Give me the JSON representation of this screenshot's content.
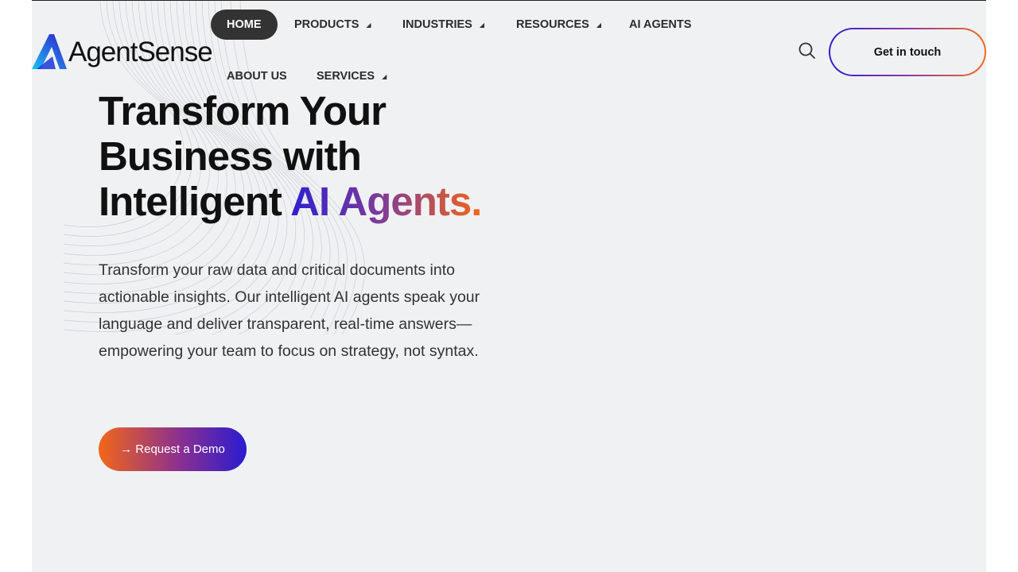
{
  "brand": {
    "name": "AgentSense"
  },
  "nav": {
    "home": "HOME",
    "products": "PRODUCTS",
    "industries": "INDUSTRIES",
    "resources": "RESOURCES",
    "ai_agents": "AI AGENTS",
    "about_us": "ABOUT US",
    "services": "SERVICES",
    "caret": "◢"
  },
  "header": {
    "cta_label": "Get in touch",
    "search_icon": "search-icon"
  },
  "hero": {
    "title_line1": "Transform Your",
    "title_line2": "Business with",
    "title_line3_plain": "Intelligent ",
    "title_line3_gradient": "AI Agents.",
    "subtitle": "Transform your raw data and critical documents into actionable insights. Our intelligent AI agents speak your language and deliver transparent, real-time answers—empowering your team to focus on strategy, not syntax.",
    "demo_button": "→ Request a Demo"
  },
  "colors": {
    "page_bg": "#f0f1f3",
    "nav_active_bg": "#333333",
    "gradient_blue": "#2f1fd0",
    "gradient_purple": "#7a3a9c",
    "gradient_orange": "#f2661a"
  }
}
